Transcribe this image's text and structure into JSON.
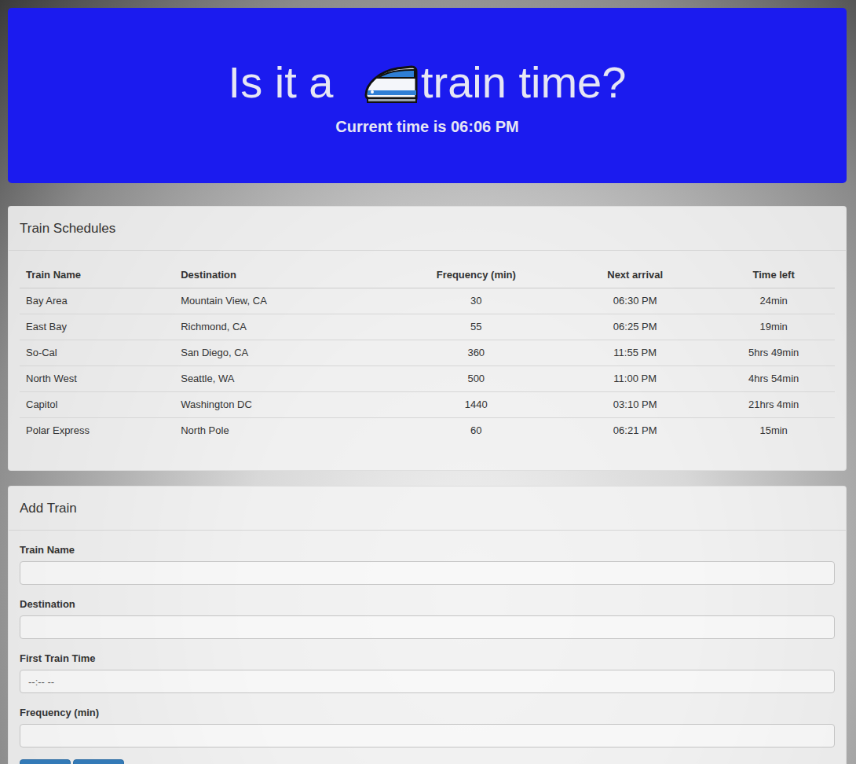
{
  "header": {
    "title_before": "Is it a ",
    "title_after": "train time?",
    "subtitle": "Current time is 06:06 PM"
  },
  "schedule": {
    "title": "Train Schedules",
    "columns": [
      "Train Name",
      "Destination",
      "Frequency (min)",
      "Next arrival",
      "Time left"
    ],
    "rows": [
      {
        "name": "Bay Area",
        "destination": "Mountain View, CA",
        "frequency": "30",
        "next_arrival": "06:30 PM",
        "time_left": "24min"
      },
      {
        "name": "East Bay",
        "destination": "Richmond, CA",
        "frequency": "55",
        "next_arrival": "06:25 PM",
        "time_left": "19min"
      },
      {
        "name": "So-Cal",
        "destination": "San Diego, CA",
        "frequency": "360",
        "next_arrival": "11:55 PM",
        "time_left": "5hrs 49min"
      },
      {
        "name": "North West",
        "destination": "Seattle, WA",
        "frequency": "500",
        "next_arrival": "11:00 PM",
        "time_left": "4hrs 54min"
      },
      {
        "name": "Capitol",
        "destination": "Washington DC",
        "frequency": "1440",
        "next_arrival": "03:10 PM",
        "time_left": "21hrs 4min"
      },
      {
        "name": "Polar Express",
        "destination": "North Pole",
        "frequency": "60",
        "next_arrival": "06:21 PM",
        "time_left": "15min"
      }
    ]
  },
  "form": {
    "title": "Add Train",
    "fields": [
      {
        "label": "Train Name",
        "placeholder": ""
      },
      {
        "label": "Destination",
        "placeholder": ""
      },
      {
        "label": "First Train Time",
        "placeholder": "--:-- --"
      },
      {
        "label": "Frequency (min)",
        "placeholder": ""
      }
    ],
    "buttons": [
      {
        "label": ""
      },
      {
        "label": ""
      }
    ]
  }
}
